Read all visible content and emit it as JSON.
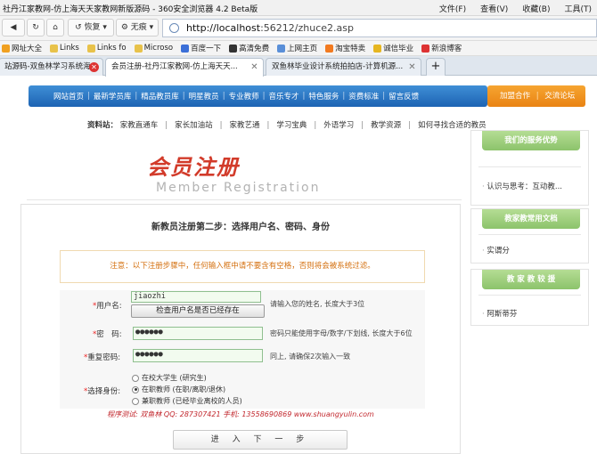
{
  "browser": {
    "title": "社丹江家教网-仿上海天天家教网新版源码 - 360安全浏览器 4.2 Beta版",
    "menu": [
      "文件(F)",
      "查看(V)",
      "收藏(B)",
      "工具(T)"
    ],
    "nav": {
      "back": "",
      "forward": "",
      "refresh": "",
      "home": "",
      "recover": "恢复",
      "nograph": "无痕"
    },
    "address": {
      "host": "http://localhost",
      "rest": ":56212/zhuce2.asp"
    },
    "bookmarks": [
      "网址大全",
      "Links",
      "Links fo",
      "Microso",
      "百度一下",
      "高清免费",
      "上网主页",
      "淘宝特卖",
      "诚信毕业",
      "新浪博客"
    ],
    "tabs": [
      {
        "label": "站源码-双鱼林学习系统海...",
        "active": false
      },
      {
        "label": "会员注册-社丹江家教网-仿上海天天...",
        "active": true
      },
      {
        "label": "双鱼林毕业设计系统拍拍店-计算机源...",
        "active": false
      }
    ],
    "new_tab": "+"
  },
  "site": {
    "nav_items": [
      "网站首页",
      "最新学员库",
      "精品教员库",
      "明星教员",
      "专业教师",
      "音乐专才",
      "特色服务",
      "资费标准",
      "留言反馈"
    ],
    "nav_right": [
      "加盟合作",
      "交流论坛"
    ],
    "sub_nav_lead": "资料站：",
    "sub_nav": [
      "家教直通车",
      "家长加油站",
      "家教艺通",
      "学习宝典",
      "外语学习",
      "教学资源",
      "如何寻找合适的教员"
    ],
    "heading_cn": "会员注册",
    "heading_en": "Member Registration"
  },
  "form": {
    "step_title": "新教员注册第二步：选择用户名、密码、身份",
    "notice": "注意：以下注册步骤中，任何输入框中请不要含有空格，否则将会被系统过滤。",
    "username": {
      "label": "用户名:",
      "value": "jiaozhi",
      "hint": "请输入您的姓名, 长度大于3位"
    },
    "check_button": "检查用户名是否已经存在",
    "password": {
      "label": "密　码:",
      "value": "●●●●●●",
      "hint": "密码只能使用字母/数字/下划线, 长度大于6位"
    },
    "confirm": {
      "label": "重复密码:",
      "value": "●●●●●●",
      "hint": "同上, 请确保2次输入一致"
    },
    "identity": {
      "label": "选择身份:",
      "options": [
        {
          "text": "在校大学生 (研究生)",
          "checked": false
        },
        {
          "text": "在职教师 (在职/离职/退休)",
          "checked": true
        },
        {
          "text": "兼职教师 (已经毕业离校的人员)",
          "checked": false
        }
      ]
    },
    "credit": "程序测试: 双鱼林  QQ: 287307421  手机: 13558690869  www.shuangyulin.com",
    "next_button": "进 入 下 一 步"
  },
  "sidebar": [
    {
      "title": "我们的服务优势",
      "items": [
        "认识与思考：互动教..."
      ]
    },
    {
      "title": "教家教常用文档",
      "items": [
        "实谓分"
      ]
    },
    {
      "title": "教 家 教 较 援",
      "items": [
        "阿斯蒂芬"
      ]
    }
  ]
}
